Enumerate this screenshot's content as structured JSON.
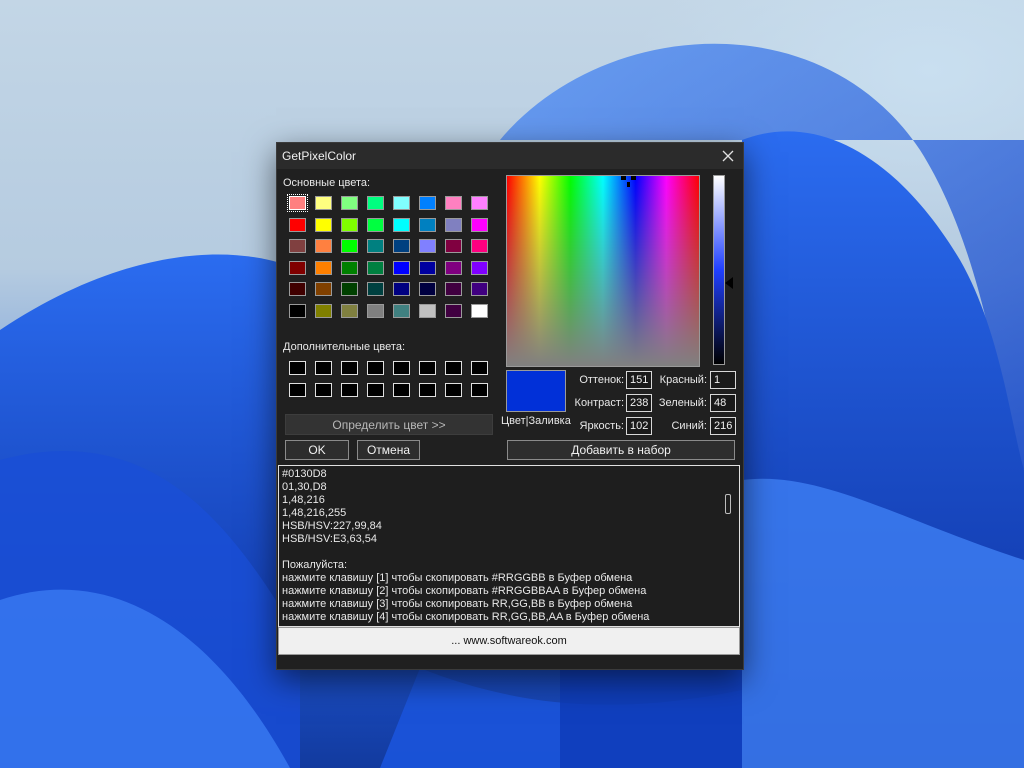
{
  "window": {
    "title": "GetPixelColor"
  },
  "basic_colors": {
    "label": "Основные цвета:",
    "swatches": [
      "#ff8080",
      "#ffff80",
      "#80ff80",
      "#00ff80",
      "#80ffff",
      "#0080ff",
      "#ff80c0",
      "#ff80ff",
      "#ff0000",
      "#ffff00",
      "#80ff00",
      "#00ff40",
      "#00ffff",
      "#0080c0",
      "#8080c0",
      "#ff00ff",
      "#804040",
      "#ff8040",
      "#00ff00",
      "#008080",
      "#004080",
      "#8080ff",
      "#800040",
      "#ff0080",
      "#800000",
      "#ff8000",
      "#008000",
      "#008040",
      "#0000ff",
      "#0000a0",
      "#800080",
      "#8000ff",
      "#400000",
      "#804000",
      "#004000",
      "#004040",
      "#000080",
      "#000040",
      "#400040",
      "#400080",
      "#000000",
      "#808000",
      "#808040",
      "#808080",
      "#408080",
      "#c0c0c0",
      "#400040",
      "#ffffff"
    ]
  },
  "custom_colors": {
    "label": "Дополнительные цвета:",
    "swatches": [
      "#000000",
      "#000000",
      "#000000",
      "#000000",
      "#000000",
      "#000000",
      "#000000",
      "#000000",
      "#000000",
      "#000000",
      "#000000",
      "#000000",
      "#000000",
      "#000000",
      "#000000",
      "#000000"
    ]
  },
  "buttons": {
    "define": "Определить цвет >>",
    "ok": "OK",
    "cancel": "Отмена",
    "add": "Добавить в набор"
  },
  "preview": {
    "label": "Цвет|Заливка",
    "color": "#0130d8"
  },
  "values": {
    "hue_label": "Оттенок:",
    "hue": "151",
    "sat_label": "Контраст:",
    "sat": "238",
    "lum_label": "Яркость:",
    "lum": "102",
    "red_label": "Красный:",
    "red": "1",
    "green_label": "Зеленый:",
    "green": "48",
    "blue_label": "Синий:",
    "blue": "216"
  },
  "output_lines": [
    "#0130D8",
    "01,30,D8",
    "1,48,216",
    "1,48,216,255",
    "HSB/HSV:227,99,84",
    "HSB/HSV:E3,63,54",
    "",
    "Пожалуйста:",
    "нажмите клавишу [1] чтобы скопировать #RRGGBB в Буфер обмена",
    "нажмите клавишу [2] чтобы скопировать #RRGGBBAA в Буфер обмена",
    "нажмите клавишу [3] чтобы скопировать RR,GG,BB в Буфер обмена",
    "нажмите клавишу [4] чтобы скопировать RR,GG,BB,AA в Буфер обмена"
  ],
  "footer": {
    "link": "... www.softwareok.com"
  },
  "colors": {
    "window_bg": "#202020",
    "accent": "#0130d8"
  }
}
